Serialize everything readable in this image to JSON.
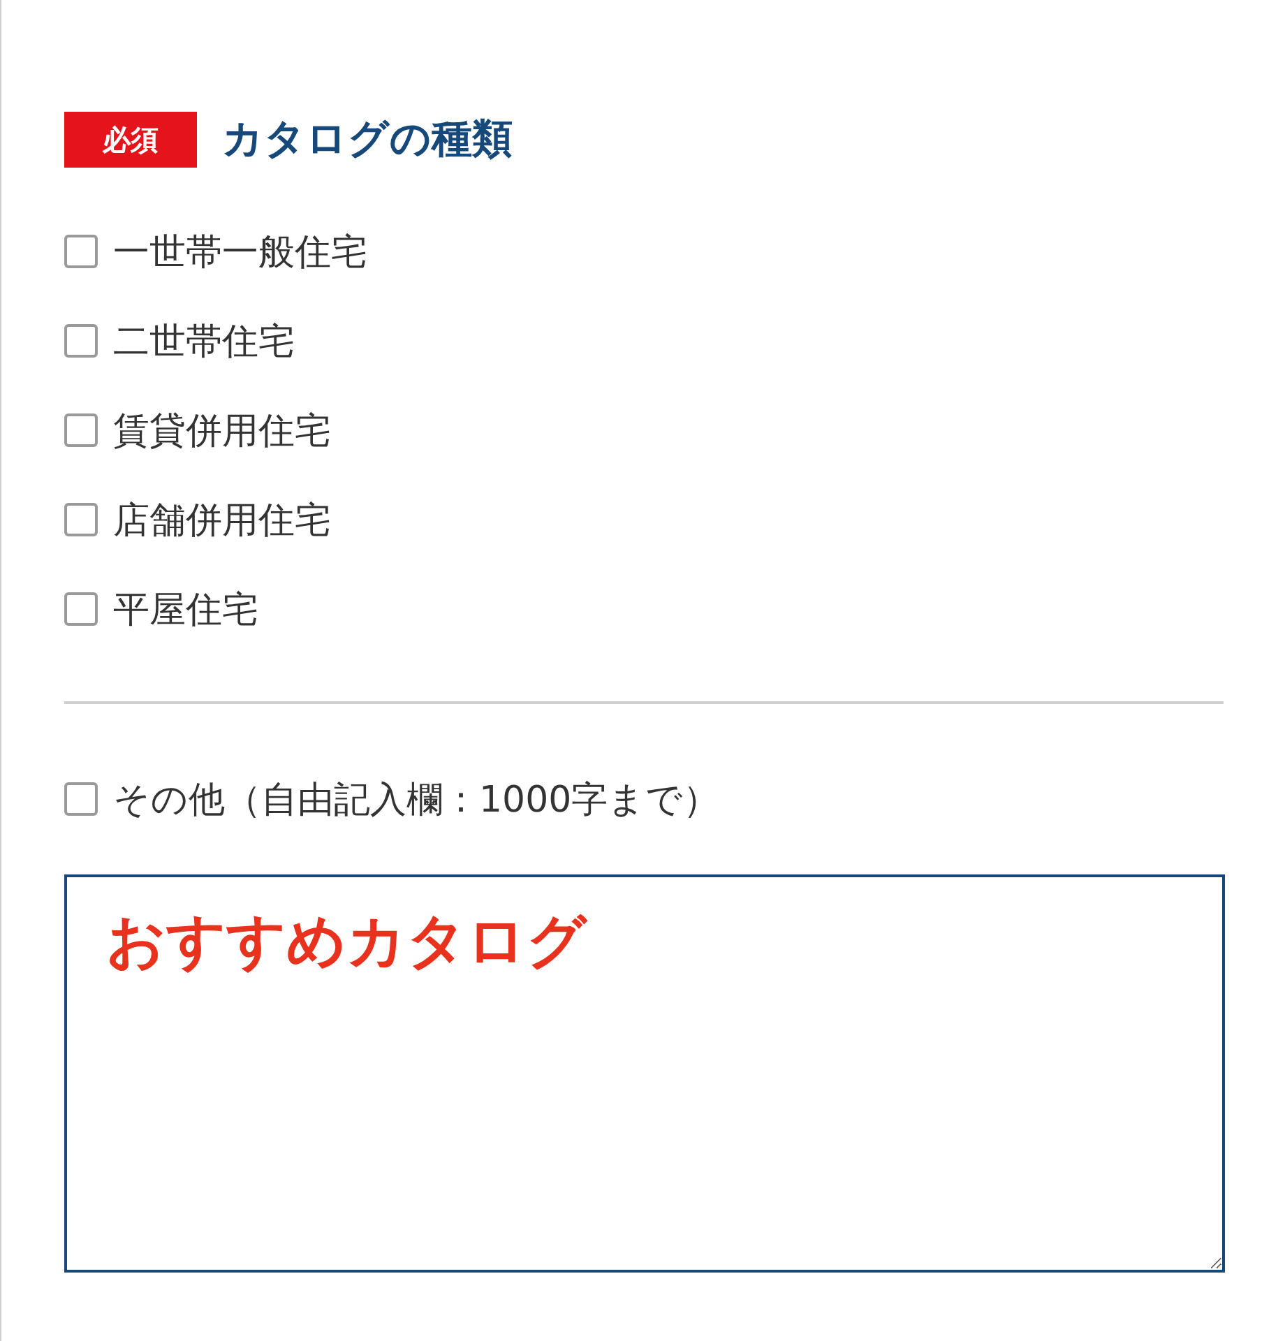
{
  "required_badge": "必須",
  "section_title": "カタログの種類",
  "options": [
    {
      "label": "一世帯一般住宅",
      "checked": false
    },
    {
      "label": "二世帯住宅",
      "checked": false
    },
    {
      "label": "賃貸併用住宅",
      "checked": false
    },
    {
      "label": "店舗併用住宅",
      "checked": false
    },
    {
      "label": "平屋住宅",
      "checked": false
    }
  ],
  "other_option": {
    "label": "その他（自由記入欄：1000字まで）",
    "checked": false
  },
  "free_text": {
    "value": "おすすめカタログ"
  }
}
